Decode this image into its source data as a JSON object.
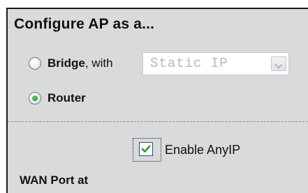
{
  "form": {
    "heading": "Configure AP as a...",
    "bridge_option": {
      "label": "Bridge",
      "suffix": ", with",
      "selected": false
    },
    "ip_mode_select": {
      "value": "Static IP",
      "disabled": true
    },
    "router_option": {
      "label": "Router",
      "selected": true
    },
    "enable_anyip": {
      "label": "Enable AnyIP",
      "checked": true
    },
    "wan_section_heading": "WAN Port at"
  },
  "colors": {
    "panel_background": "#d9dadc",
    "radio_selected_dot": "#2f9a2f",
    "checkmark": "#2e9a2e",
    "disabled_text": "#b5b8bd"
  },
  "icons": {
    "radio_unselected": "radio-off",
    "radio_selected": "radio-on",
    "checkbox_checked": "check",
    "dropdown_arrow": "chevron-down"
  }
}
